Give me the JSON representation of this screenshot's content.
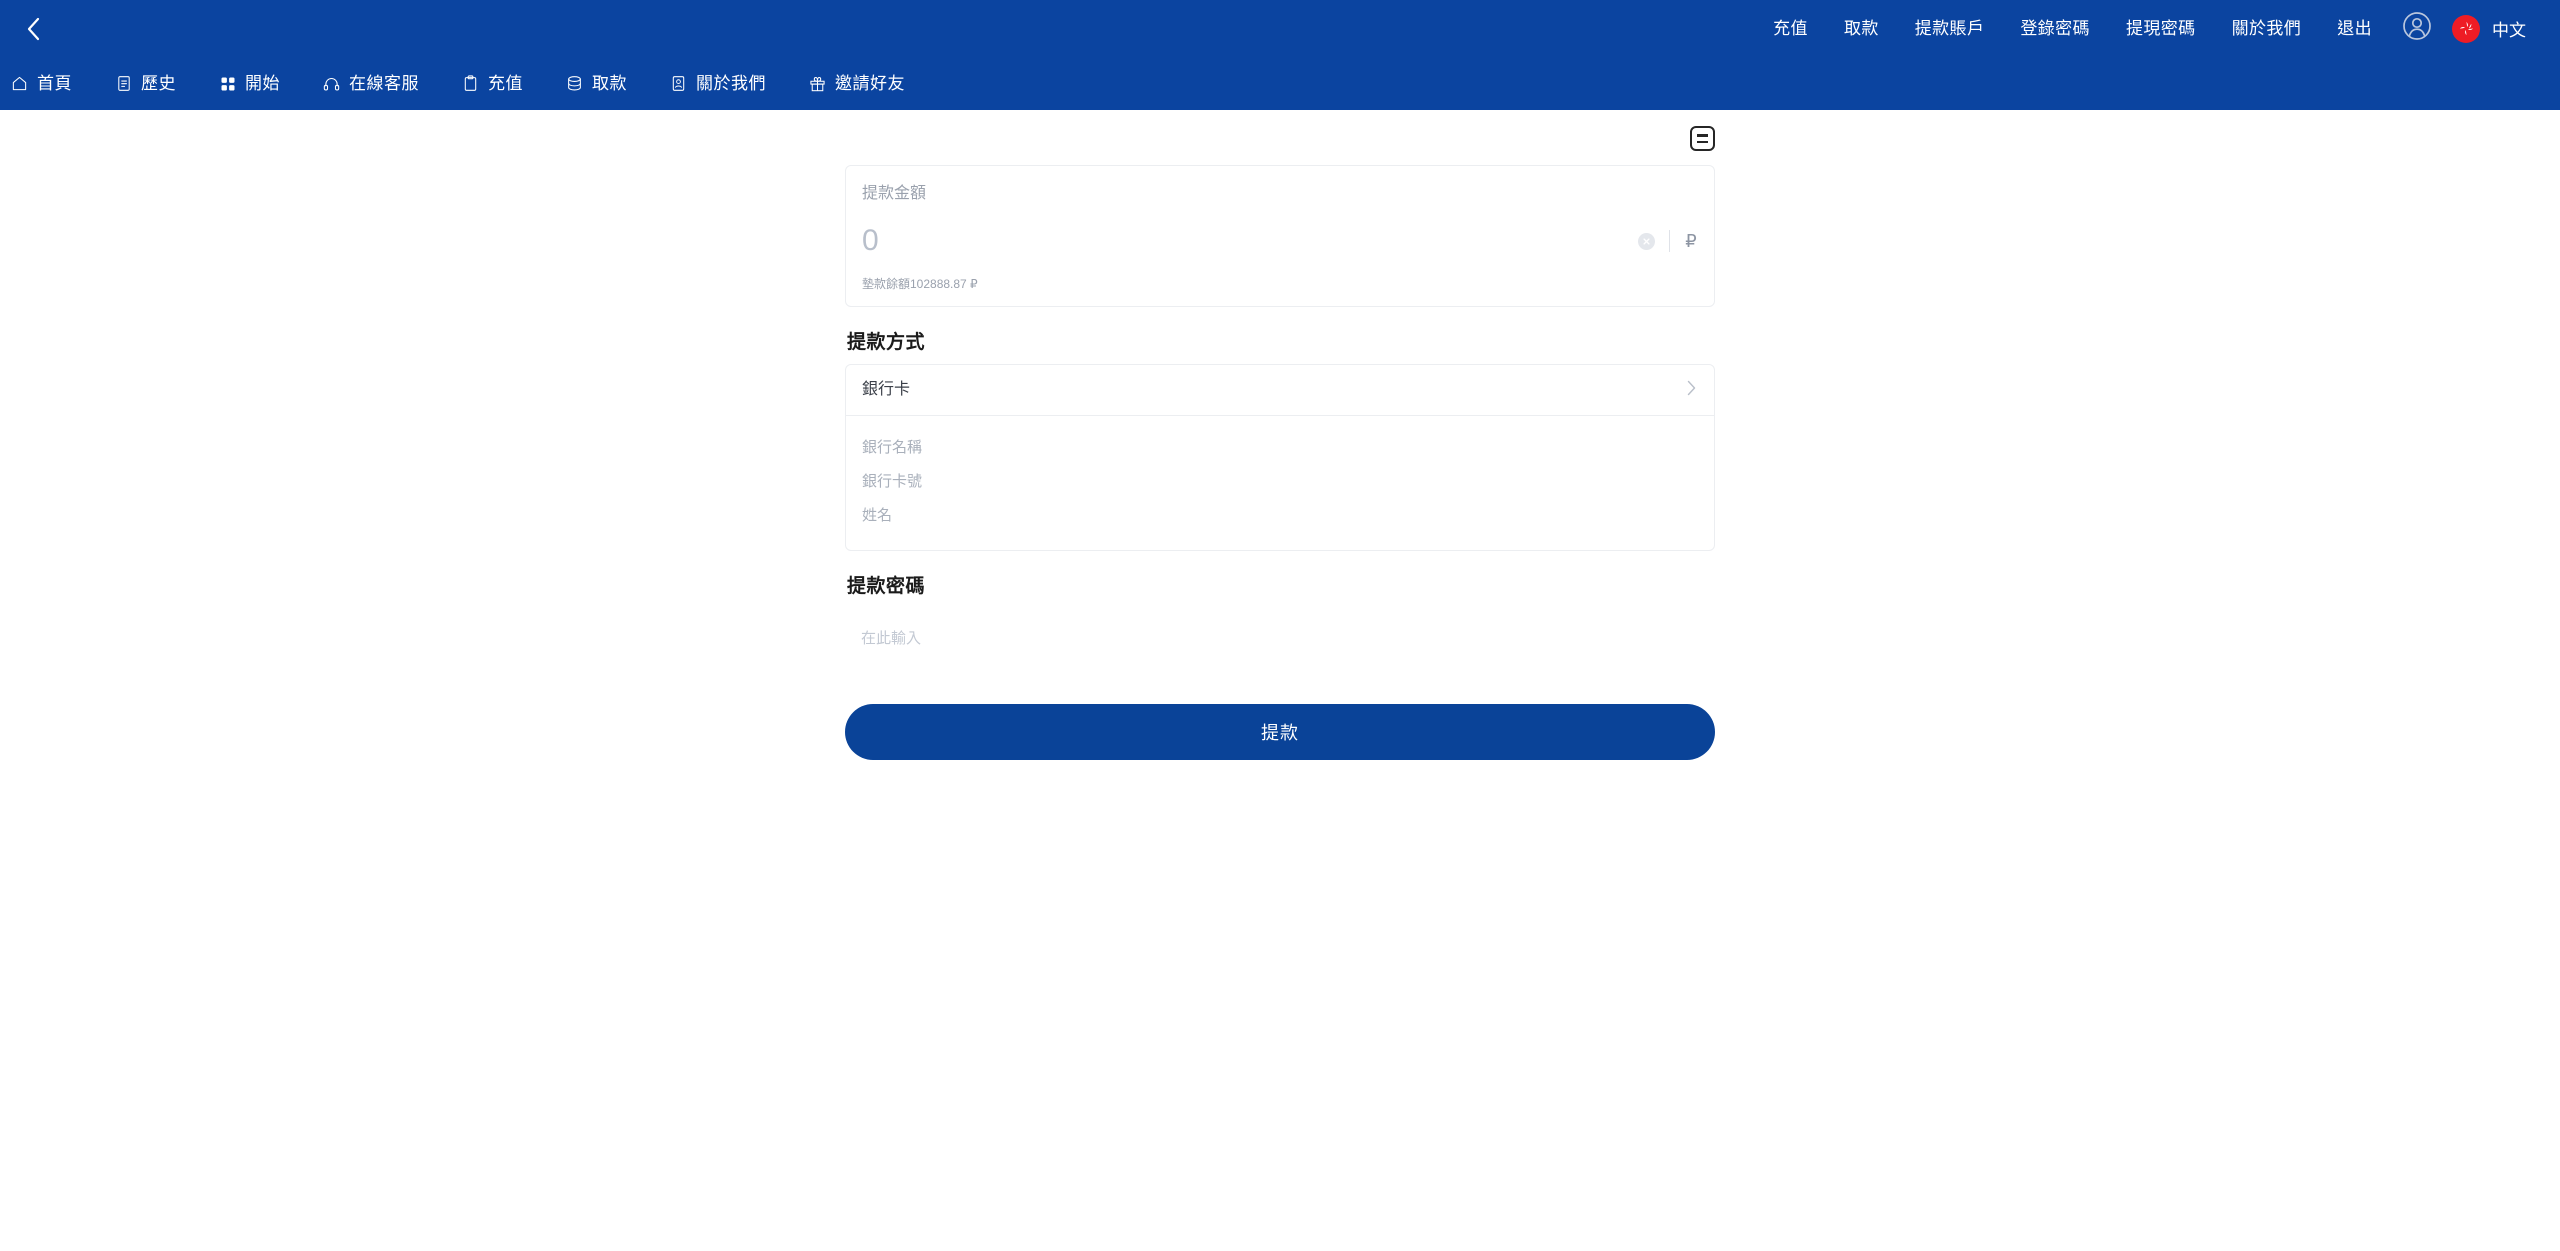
{
  "header": {
    "back_icon": "chevron-left-icon",
    "top_menu": [
      {
        "label": "充值",
        "icon": "deposit-link"
      },
      {
        "label": "取款",
        "icon": "withdraw-link"
      },
      {
        "label": "提款賬戶",
        "icon": "withdraw-account-link"
      },
      {
        "label": "登錄密碼",
        "icon": "login-password-link"
      },
      {
        "label": "提現密碼",
        "icon": "withdraw-password-link"
      },
      {
        "label": "關於我們",
        "icon": "about-us-link"
      },
      {
        "label": "退出",
        "icon": "logout-link"
      }
    ],
    "account_icon": "user-circle-icon",
    "language": {
      "flag_icon": "hongkong-flag-icon",
      "label": "中文"
    },
    "brand_color": "#0b44a0"
  },
  "nav": {
    "items": [
      {
        "label": "首頁",
        "icon": "home-icon"
      },
      {
        "label": "歷史",
        "icon": "document-icon"
      },
      {
        "label": "開始",
        "icon": "grid-icon"
      },
      {
        "label": "在線客服",
        "icon": "headset-icon"
      },
      {
        "label": "充值",
        "icon": "clipboard-icon"
      },
      {
        "label": "取款",
        "icon": "coins-stack-icon"
      },
      {
        "label": "關於我們",
        "icon": "id-card-icon"
      },
      {
        "label": "邀請好友",
        "icon": "gift-icon"
      }
    ]
  },
  "main": {
    "records_icon": "records-list-icon",
    "amount": {
      "label": "提款金額",
      "value": "0",
      "clear_icon": "clear-circle-icon",
      "currency_symbol": "₽",
      "balance_note": "墊款餘額102888.87 ₽"
    },
    "method": {
      "title": "提款方式",
      "selected": "銀行卡",
      "chevron_icon": "chevron-right-icon",
      "fields": [
        {
          "placeholder": "銀行名稱",
          "name": "bank-name-input"
        },
        {
          "placeholder": "銀行卡號",
          "name": "bank-card-number-input"
        },
        {
          "placeholder": "姓名",
          "name": "account-holder-name-input"
        }
      ]
    },
    "password": {
      "title": "提款密碼",
      "placeholder": "在此輸入"
    },
    "submit": {
      "label": "提款",
      "color": "#0a4398"
    }
  }
}
